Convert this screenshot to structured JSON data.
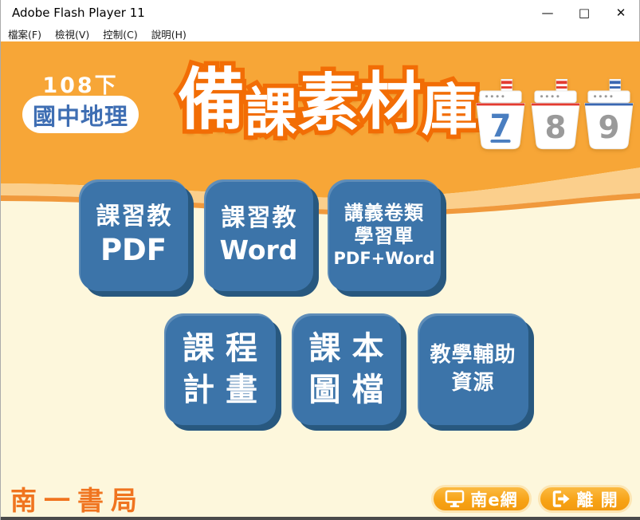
{
  "window": {
    "title": "Adobe Flash Player 11",
    "minimize": "—",
    "maximize": "□",
    "close": "✕"
  },
  "menu": {
    "items": [
      "檔案(F)",
      "檢視(V)",
      "控制(C)",
      "說明(H)"
    ]
  },
  "header": {
    "edition": "108下",
    "subject": "國中地理",
    "title_chars": [
      "備",
      "課",
      "素",
      "材",
      "庫"
    ],
    "boats": [
      {
        "number": "7",
        "active": true,
        "stripe_color": "#E33B30"
      },
      {
        "number": "8",
        "active": false,
        "stripe_color": "#E33B30"
      },
      {
        "number": "9",
        "active": false,
        "stripe_color": "#3A67B1"
      }
    ]
  },
  "buttons": {
    "row1": [
      {
        "lines": [
          "課習教",
          "PDF"
        ]
      },
      {
        "lines": [
          "課習教",
          "Word"
        ]
      },
      {
        "lines": [
          "講義卷類",
          "學習單",
          "PDF+Word"
        ]
      }
    ],
    "row2": [
      {
        "lines": [
          "課程",
          "計畫"
        ]
      },
      {
        "lines": [
          "課本",
          "圖檔"
        ]
      },
      {
        "lines": [
          "教學輔助",
          "資源"
        ]
      }
    ]
  },
  "footer": {
    "logo": "南一書局",
    "portal": "南e網",
    "exit": "離 開"
  },
  "colors": {
    "header_orange": "#F7A637",
    "wave_light": "#FBCF8C",
    "wave_stripe": "#F0993C",
    "cream": "#FDF7DC",
    "tile_blue": "#3C74A9",
    "tile_shadow": "#28587F",
    "title_stroke": "#F26D05",
    "badge_blue": "#3E6EB3",
    "active_number": "#4A7EC0",
    "inactive_number": "#9A9A9A"
  }
}
